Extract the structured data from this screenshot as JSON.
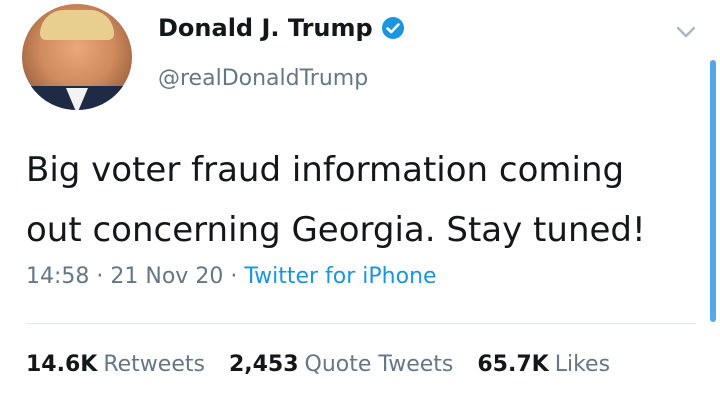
{
  "author": {
    "name": "Donald J. Trump",
    "handle": "@realDonaldTrump",
    "verified": true,
    "avatar_icon": "profile-photo"
  },
  "tweet": {
    "text_line1": "Big voter fraud information coming",
    "text_line2": "out concerning Georgia. Stay tuned!",
    "time": "14:58",
    "date": "21 Nov 20",
    "separator": "·",
    "source": "Twitter for iPhone"
  },
  "stats": {
    "retweets_count": "14.6K",
    "retweets_label": "Retweets",
    "quotes_count": "2,453",
    "quotes_label": "Quote Tweets",
    "likes_count": "65.7K",
    "likes_label": "Likes"
  },
  "colors": {
    "accent": "#1b95e0",
    "secondary_text": "#657786",
    "primary_text": "#14171a",
    "scrollbar": "#55a8e8"
  },
  "icons": {
    "verified": "verified-badge-icon",
    "menu": "chevron-down-icon"
  }
}
